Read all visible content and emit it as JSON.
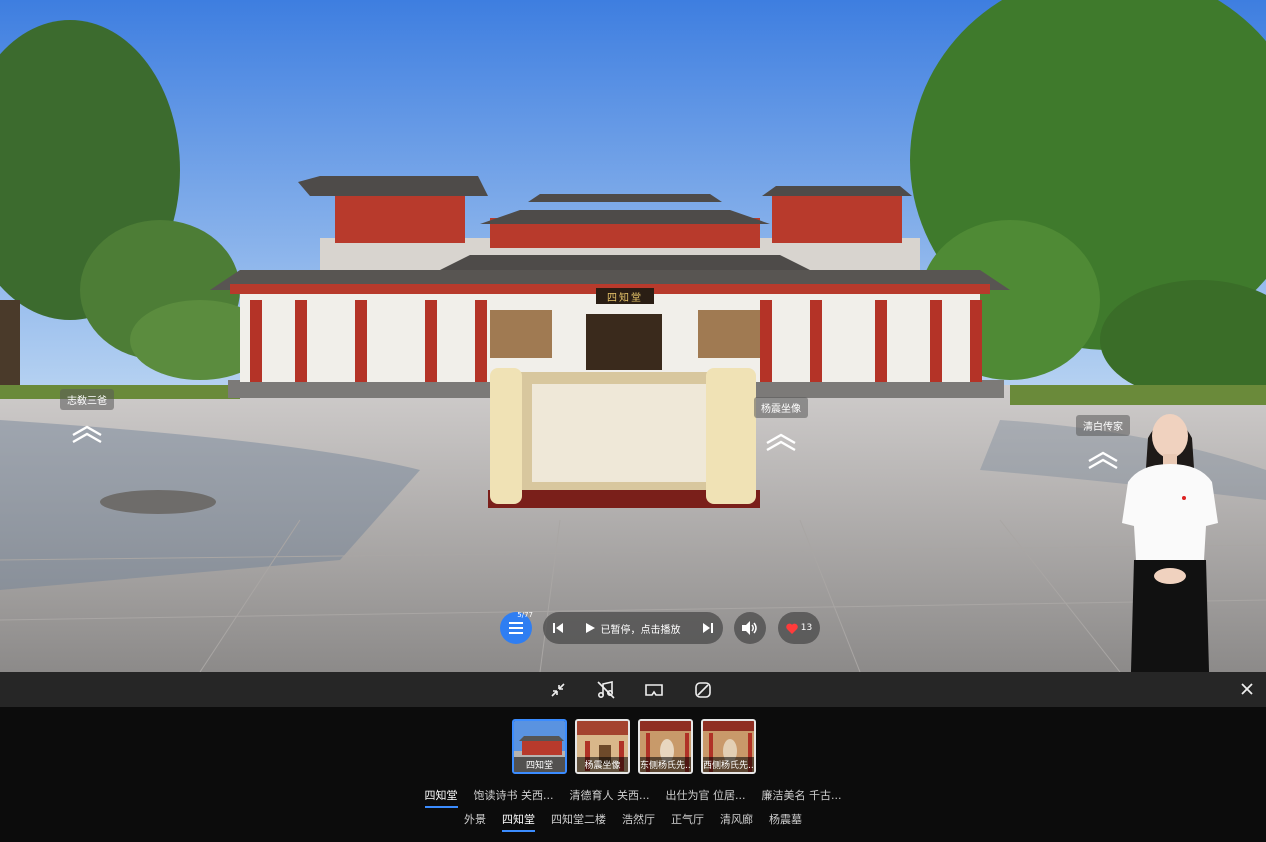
{
  "hotspots": [
    {
      "name": "hotspot-zhijiao-sanba",
      "label": "志敎三爸"
    },
    {
      "name": "hotspot-yangzhen-statue",
      "label": "杨震坐像"
    },
    {
      "name": "hotspot-qingbai-chuanjia",
      "label": "清白传家"
    }
  ],
  "signboard": "四知堂",
  "player": {
    "playlist_badge": "5/77",
    "status": "已暂停，点击播放",
    "like_count": "13"
  },
  "toolbar": {
    "icons": [
      "collapse-icon",
      "music-off-icon",
      "vr-glasses-icon",
      "gyroscope-icon",
      "close-icon"
    ]
  },
  "thumbnails": [
    {
      "label": "四知堂",
      "active": true
    },
    {
      "label": "杨震坐像",
      "active": false
    },
    {
      "label": "东侧杨氏先...",
      "active": false
    },
    {
      "label": "西侧杨氏先...",
      "active": false
    }
  ],
  "scene_tabs": [
    "四知堂",
    "饱读诗书 关西...",
    "清德育人 关西...",
    "出仕为官 位居...",
    "廉洁美名 千古..."
  ],
  "group_tabs": [
    "外景",
    "四知堂",
    "四知堂二楼",
    "浩然厅",
    "正气厅",
    "清风廊",
    "杨震墓"
  ],
  "colors": {
    "accent": "#3b8cff",
    "menu_button": "#2f7ef2",
    "like_heart": "#ff3b3b"
  }
}
